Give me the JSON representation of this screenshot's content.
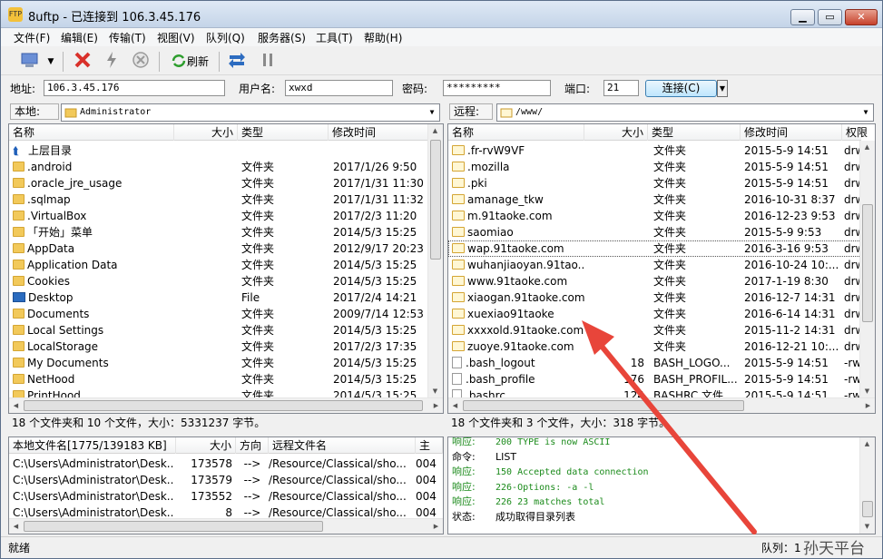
{
  "window": {
    "title": "8uftp - 已连接到 106.3.45.176",
    "app_icon": "FTP"
  },
  "menu": [
    "文件(F)",
    "编辑(E)",
    "传输(T)",
    "视图(V)",
    "队列(Q)",
    "服务器(S)",
    "工具(T)",
    "帮助(H)"
  ],
  "toolbar": {
    "refresh_label": "刷新"
  },
  "conn": {
    "addr_label": "地址:",
    "addr": "106.3.45.176",
    "user_label": "用户名:",
    "user": "xwxd",
    "pwd_label": "密码:",
    "pwd": "*********",
    "port_label": "端口:",
    "port": "21",
    "connect_label": "连接(C)"
  },
  "local": {
    "path_label": "本地:",
    "path": "Administrator",
    "headers": [
      "名称",
      "大小",
      "类型",
      "修改时间"
    ],
    "rows": [
      {
        "name": "上层目录",
        "size": "",
        "type": "",
        "date": "",
        "icon": "up"
      },
      {
        "name": ".android",
        "size": "",
        "type": "文件夹",
        "date": "2017/1/26 9:50",
        "icon": "folder"
      },
      {
        "name": ".oracle_jre_usage",
        "size": "",
        "type": "文件夹",
        "date": "2017/1/31 11:30",
        "icon": "folder"
      },
      {
        "name": ".sqlmap",
        "size": "",
        "type": "文件夹",
        "date": "2017/1/31 11:32",
        "icon": "folder"
      },
      {
        "name": ".VirtualBox",
        "size": "",
        "type": "文件夹",
        "date": "2017/2/3 11:20",
        "icon": "folder"
      },
      {
        "name": "「开始」菜单",
        "size": "",
        "type": "文件夹",
        "date": "2014/5/3 15:25",
        "icon": "folder"
      },
      {
        "name": "AppData",
        "size": "",
        "type": "文件夹",
        "date": "2012/9/17 20:23",
        "icon": "folder"
      },
      {
        "name": "Application Data",
        "size": "",
        "type": "文件夹",
        "date": "2014/5/3 15:25",
        "icon": "folder"
      },
      {
        "name": "Cookies",
        "size": "",
        "type": "文件夹",
        "date": "2014/5/3 15:25",
        "icon": "folder"
      },
      {
        "name": "Desktop",
        "size": "",
        "type": "File",
        "date": "2017/2/4 14:21",
        "icon": "desktop"
      },
      {
        "name": "Documents",
        "size": "",
        "type": "文件夹",
        "date": "2009/7/14 12:53",
        "icon": "folder"
      },
      {
        "name": "Local Settings",
        "size": "",
        "type": "文件夹",
        "date": "2014/5/3 15:25",
        "icon": "folder"
      },
      {
        "name": "LocalStorage",
        "size": "",
        "type": "文件夹",
        "date": "2017/2/3 17:35",
        "icon": "folder"
      },
      {
        "name": "My Documents",
        "size": "",
        "type": "文件夹",
        "date": "2014/5/3 15:25",
        "icon": "folder"
      },
      {
        "name": "NetHood",
        "size": "",
        "type": "文件夹",
        "date": "2014/5/3 15:25",
        "icon": "folder"
      },
      {
        "name": "PrintHood",
        "size": "",
        "type": "文件夹",
        "date": "2014/5/3 15:25",
        "icon": "folder"
      }
    ],
    "status": "18 个文件夹和 10 个文件，大小：5331237 字节。"
  },
  "remote": {
    "path_label": "远程:",
    "path": "/www/",
    "headers": [
      "名称",
      "大小",
      "类型",
      "修改时间",
      "权限"
    ],
    "rows": [
      {
        "name": ".fr-rvW9VF",
        "size": "",
        "type": "文件夹",
        "date": "2015-5-9 14:51",
        "perm": "drw",
        "icon": "folder"
      },
      {
        "name": ".mozilla",
        "size": "",
        "type": "文件夹",
        "date": "2015-5-9 14:51",
        "perm": "drw",
        "icon": "folder"
      },
      {
        "name": ".pki",
        "size": "",
        "type": "文件夹",
        "date": "2015-5-9 14:51",
        "perm": "drw",
        "icon": "folder"
      },
      {
        "name": "amanage_tkw",
        "size": "",
        "type": "文件夹",
        "date": "2016-10-31 8:37",
        "perm": "drw",
        "icon": "folder"
      },
      {
        "name": "m.91taoke.com",
        "size": "",
        "type": "文件夹",
        "date": "2016-12-23 9:53",
        "perm": "drw",
        "icon": "folder"
      },
      {
        "name": "saomiao",
        "size": "",
        "type": "文件夹",
        "date": "2015-5-9 9:53",
        "perm": "drw",
        "icon": "folder"
      },
      {
        "name": "wap.91taoke.com",
        "size": "",
        "type": "文件夹",
        "date": "2016-3-16 9:53",
        "perm": "drw",
        "icon": "folder"
      },
      {
        "name": "wuhanjiaoyan.91tao...",
        "size": "",
        "type": "文件夹",
        "date": "2016-10-24 10:...",
        "perm": "drw",
        "icon": "folder"
      },
      {
        "name": "www.91taoke.com",
        "size": "",
        "type": "文件夹",
        "date": "2017-1-19 8:30",
        "perm": "drw",
        "icon": "folder"
      },
      {
        "name": "xiaogan.91taoke.com",
        "size": "",
        "type": "文件夹",
        "date": "2016-12-7 14:31",
        "perm": "drw",
        "icon": "folder"
      },
      {
        "name": "xuexiao91taoke",
        "size": "",
        "type": "文件夹",
        "date": "2016-6-14 14:31",
        "perm": "drw",
        "icon": "folder"
      },
      {
        "name": "xxxxold.91taoke.com",
        "size": "",
        "type": "文件夹",
        "date": "2015-11-2 14:31",
        "perm": "drw",
        "icon": "folder"
      },
      {
        "name": "zuoye.91taoke.com",
        "size": "",
        "type": "文件夹",
        "date": "2016-12-21 10:...",
        "perm": "drw",
        "icon": "folder"
      },
      {
        "name": ".bash_logout",
        "size": "18",
        "type": "BASH_LOGO...",
        "date": "2015-5-9 14:51",
        "perm": "-rw",
        "icon": "file"
      },
      {
        "name": ".bash_profile",
        "size": "176",
        "type": "BASH_PROFIL...",
        "date": "2015-5-9 14:51",
        "perm": "-rw",
        "icon": "file"
      },
      {
        "name": ".bashrc",
        "size": "124",
        "type": "BASHRC 文件",
        "date": "2015-5-9 14:51",
        "perm": "-rw",
        "icon": "file"
      }
    ],
    "status": "18 个文件夹和 3 个文件，大小：318 字节。"
  },
  "queue": {
    "headers": [
      "本地文件名[1775/139183 KB]",
      "大小",
      "方向",
      "远程文件名",
      "主"
    ],
    "rows": [
      {
        "local": "C:\\Users\\Administrator\\Desk...",
        "size": "173578",
        "dir": "-->",
        "remote": "/Resource/Classical/sho...",
        "extra": "004"
      },
      {
        "local": "C:\\Users\\Administrator\\Desk...",
        "size": "173579",
        "dir": "-->",
        "remote": "/Resource/Classical/sho...",
        "extra": "004"
      },
      {
        "local": "C:\\Users\\Administrator\\Desk...",
        "size": "173552",
        "dir": "-->",
        "remote": "/Resource/Classical/sho...",
        "extra": "004"
      },
      {
        "local": "C:\\Users\\Administrator\\Desk...",
        "size": "8",
        "dir": "-->",
        "remote": "/Resource/Classical/sho...",
        "extra": "004"
      }
    ]
  },
  "log": [
    {
      "k": "响应:",
      "v": "200 TYPE is now ASCII",
      "green": true
    },
    {
      "k": "命令:",
      "v": "LIST",
      "green": false
    },
    {
      "k": "响应:",
      "v": "150 Accepted data connection",
      "green": true
    },
    {
      "k": "响应:",
      "v": "226-Options: -a -l",
      "green": true
    },
    {
      "k": "响应:",
      "v": "226 23 matches total",
      "green": true
    },
    {
      "k": "状态:",
      "v": "成功取得目录列表",
      "green": false
    }
  ],
  "statusbar": {
    "left": "就绪",
    "right": "队列：1",
    "watermark": "孙天平台"
  },
  "colors": {
    "arrow": "#e8453a",
    "log_green": "#1a8a1a"
  }
}
